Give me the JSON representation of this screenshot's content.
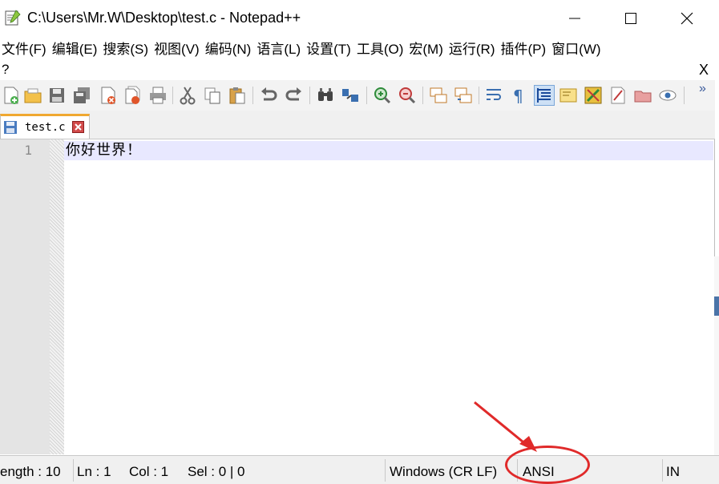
{
  "window": {
    "title": "C:\\Users\\Mr.W\\Desktop\\test.c - Notepad++",
    "app_icon": "notepad-plus-plus-icon",
    "controls": [
      "minimize-icon",
      "maximize-icon",
      "close-icon"
    ]
  },
  "menu": {
    "items": [
      {
        "label": "文件(F)"
      },
      {
        "label": "编辑(E)"
      },
      {
        "label": "搜索(S)"
      },
      {
        "label": "视图(V)"
      },
      {
        "label": "编码(N)"
      },
      {
        "label": "语言(L)"
      },
      {
        "label": "设置(T)"
      },
      {
        "label": "工具(O)"
      },
      {
        "label": "宏(M)"
      },
      {
        "label": "运行(R)"
      },
      {
        "label": "插件(P)"
      },
      {
        "label": "窗口(W)"
      }
    ],
    "help_label": "?",
    "close_doc_label": "X"
  },
  "toolbar": {
    "icons": [
      "new-file-icon",
      "open-file-icon",
      "save-icon",
      "save-all-icon",
      "close-icon",
      "close-all-icon",
      "print-icon",
      "cut-icon",
      "copy-icon",
      "paste-icon",
      "undo-icon",
      "redo-icon",
      "find-icon",
      "replace-icon",
      "zoom-in-icon",
      "zoom-out-icon",
      "sync-vertical-icon",
      "sync-horizontal-icon",
      "word-wrap-icon",
      "show-all-chars-icon",
      "indent-guide-icon",
      "document-map-icon",
      "function-list-icon",
      "folder-as-workspace-icon",
      "monitoring-icon"
    ],
    "more_label": "»"
  },
  "tabs": [
    {
      "label": "test.c",
      "active": true
    }
  ],
  "editor": {
    "lines": [
      {
        "number": "1",
        "text": "你好世界！"
      }
    ]
  },
  "status": {
    "length": "ength : 10",
    "ln": "Ln : 1",
    "col": "Col : 1",
    "sel": "Sel : 0 | 0",
    "eol": "Windows (CR LF)",
    "encoding": "ANSI",
    "mode": "IN"
  },
  "colors": {
    "current_line": "#e8e8ff",
    "tab_accent": "#f0a830",
    "annotation": "#e02a2a"
  }
}
